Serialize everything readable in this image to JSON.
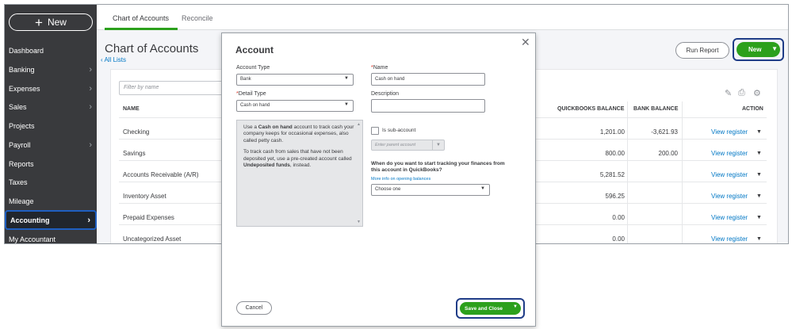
{
  "sidebar": {
    "new_label": "New",
    "items": [
      {
        "label": "Dashboard",
        "chevron": false
      },
      {
        "label": "Banking",
        "chevron": true
      },
      {
        "label": "Expenses",
        "chevron": true
      },
      {
        "label": "Sales",
        "chevron": true
      },
      {
        "label": "Projects",
        "chevron": false
      },
      {
        "label": "Payroll",
        "chevron": true
      },
      {
        "label": "Reports",
        "chevron": false
      },
      {
        "label": "Taxes",
        "chevron": false
      },
      {
        "label": "Mileage",
        "chevron": false
      },
      {
        "label": "Accounting",
        "chevron": true,
        "active": true
      },
      {
        "label": "My Accountant",
        "chevron": false
      }
    ]
  },
  "tabs": [
    "Chart of Accounts",
    "Reconcile"
  ],
  "page": {
    "title": "Chart of Accounts",
    "all_lists": "All Lists",
    "run_report": "Run Report",
    "new_label": "New"
  },
  "table": {
    "filter_placeholder": "Filter by name",
    "headers": {
      "name": "NAME",
      "qb_balance": "QUICKBOOKS BALANCE",
      "bank_balance": "BANK BALANCE",
      "action": "ACTION"
    },
    "rows": [
      {
        "name": "Checking",
        "qb_balance": "1,201.00",
        "bank_balance": "-3,621.93",
        "action": "View register"
      },
      {
        "name": "Savings",
        "qb_balance": "800.00",
        "bank_balance": "200.00",
        "action": "View register"
      },
      {
        "name": "Accounts Receivable (A/R)",
        "qb_balance": "5,281.52",
        "bank_balance": "",
        "action": "View register"
      },
      {
        "name": "Inventory Asset",
        "qb_balance": "596.25",
        "bank_balance": "",
        "action": "View register"
      },
      {
        "name": "Prepaid Expenses",
        "qb_balance": "0.00",
        "bank_balance": "",
        "action": "View register"
      },
      {
        "name": "Uncategorized Asset",
        "qb_balance": "0.00",
        "bank_balance": "",
        "action": "View register"
      }
    ]
  },
  "dialog": {
    "title": "Account",
    "account_type_label": "Account Type",
    "account_type_value": "Bank",
    "detail_type_label": "Detail Type",
    "detail_type_value": "Cash on hand",
    "name_label": "Name",
    "name_value": "Cash on hand",
    "description_label": "Description",
    "description_value": "",
    "info_p1_pre": "Use a ",
    "info_p1_bold": "Cash on hand",
    "info_p1_post": " account to track cash your company keeps for occasional expenses, also called petty cash.",
    "info_p2_pre": "To track cash from sales that have not been deposited yet, use a pre-created account called ",
    "info_p2_bold": "Undeposited funds",
    "info_p2_post": ", instead.",
    "sub_account_label": "Is sub-account",
    "parent_placeholder": "Enter parent account",
    "tracking_question": "When do you want to start tracking your finances from this account in QuickBooks?",
    "more_info_link": "More info on opening balances",
    "tracking_select_value": "Choose one",
    "cancel_label": "Cancel",
    "save_label": "Save and Close"
  },
  "colors": {
    "brand_green": "#2ca01c",
    "link_blue": "#0077c5",
    "sidebar_bg": "#393a3d",
    "focus_outline": "#1f3c87"
  }
}
